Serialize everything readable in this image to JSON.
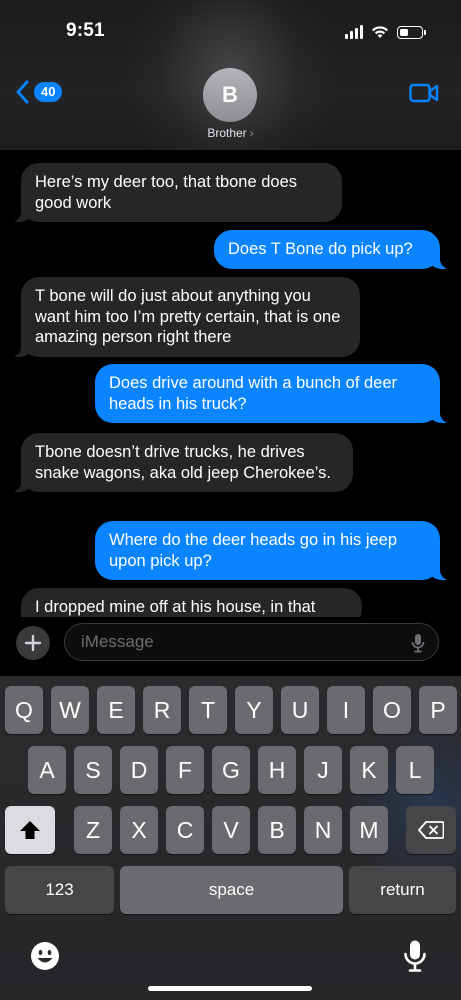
{
  "status_bar": {
    "time": "9:51"
  },
  "header": {
    "back_count": "40",
    "avatar_initial": "B",
    "contact_name": "Brother",
    "chevron": "›"
  },
  "messages": [
    {
      "direction": "incoming",
      "text": "Here’s my deer too, that tbone does good work"
    },
    {
      "direction": "outgoing",
      "text": "Does T Bone do pick up?"
    },
    {
      "direction": "incoming",
      "text": "T bone will do just about anything you want him too I’m pretty certain, that is one amazing person right there"
    },
    {
      "direction": "outgoing",
      "text": "Does drive around with a bunch of deer heads in his truck?"
    },
    {
      "direction": "incoming",
      "text": "Tbone doesn’t drive trucks, he drives snake wagons, aka old jeep Cherokee’s."
    },
    {
      "direction": "outgoing",
      "text": "Where do the deer heads go in his jeep upon pick up?"
    },
    {
      "direction": "incoming",
      "text": "I dropped mine off at his house, in that"
    }
  ],
  "composer": {
    "placeholder": "iMessage"
  },
  "keyboard": {
    "row1": [
      "Q",
      "W",
      "E",
      "R",
      "T",
      "Y",
      "U",
      "I",
      "O",
      "P"
    ],
    "row2": [
      "A",
      "S",
      "D",
      "F",
      "G",
      "H",
      "J",
      "K",
      "L"
    ],
    "row3": [
      "Z",
      "X",
      "C",
      "V",
      "B",
      "N",
      "M"
    ],
    "numbers_label": "123",
    "space_label": "space",
    "return_label": "return"
  },
  "icons": {
    "back": "chevron-left-icon",
    "video": "video-camera-icon",
    "plus": "plus-icon",
    "mic": "microphone-icon",
    "shift": "shift-icon",
    "delete": "delete-icon",
    "emoji": "emoji-icon"
  },
  "colors": {
    "accent": "#0a84ff",
    "incoming_bubble": "#262629",
    "background": "#000000"
  }
}
